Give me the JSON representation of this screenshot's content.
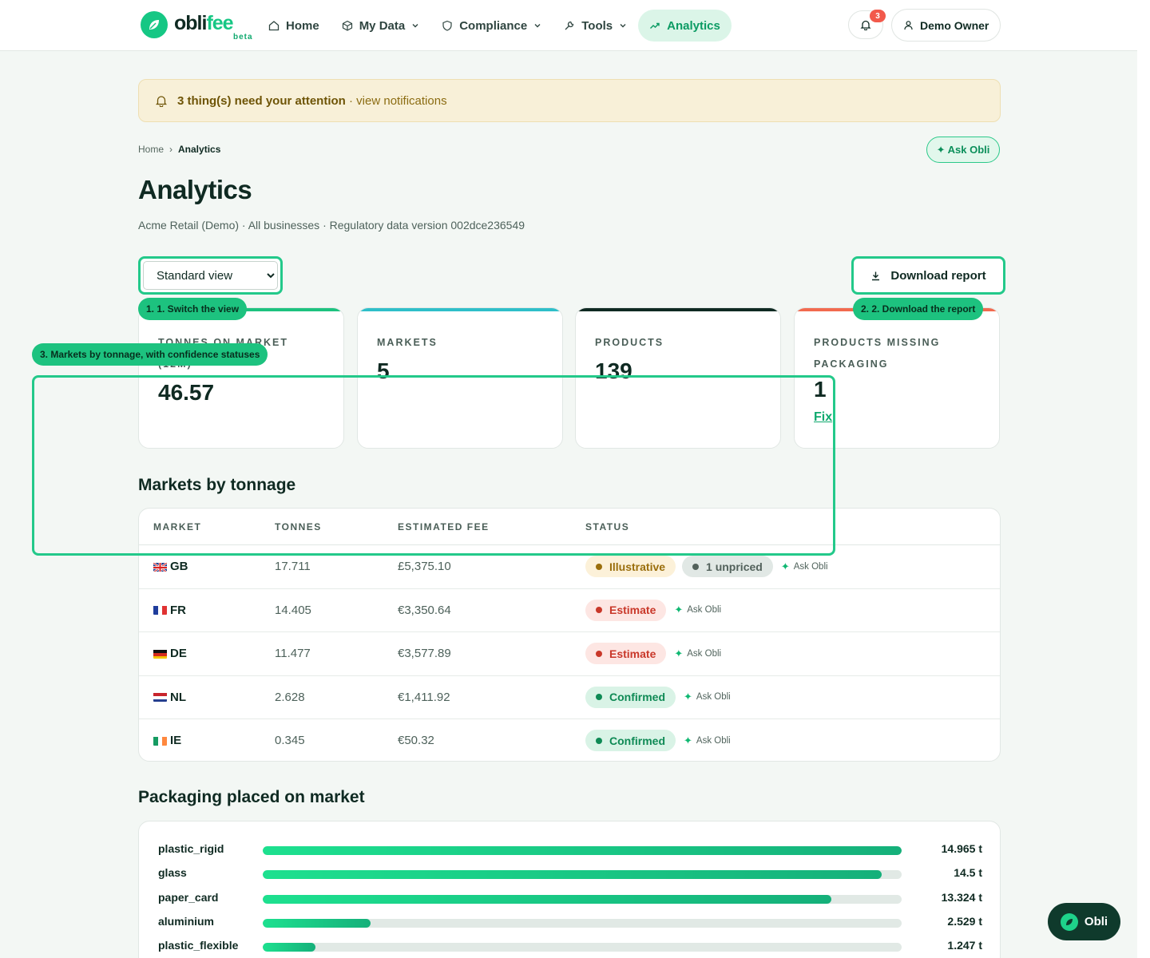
{
  "brand": {
    "name_a": "obli",
    "name_b": "fee",
    "tag": "beta"
  },
  "nav": [
    {
      "label": "Home",
      "icon": "home-icon"
    },
    {
      "label": "My Data",
      "icon": "box-icon"
    },
    {
      "label": "Compliance",
      "icon": "shield-icon"
    },
    {
      "label": "Tools",
      "icon": "wrench-icon"
    },
    {
      "label": "Analytics",
      "icon": "trend-icon",
      "active": true
    }
  ],
  "notifications": {
    "count": "3"
  },
  "user": {
    "name": "Demo Owner"
  },
  "banner": {
    "strong": "3 thing(s) need your attention",
    "link": "· view notifications"
  },
  "breadcrumb": {
    "home": "Home",
    "sep": "›",
    "current": "Analytics"
  },
  "ask_obli_label": "✦ Ask Obli",
  "page": {
    "title": "Analytics",
    "subtitle": "Acme Retail (Demo) · All businesses · Regulatory data version 002dce236549"
  },
  "view_select": {
    "selected": "Standard view"
  },
  "download_label": "Download report",
  "tour": {
    "step1": "1. 1. Switch the view",
    "step2": "2. 2. Download the report",
    "step3": "3. Markets by tonnage, with confidence statuses"
  },
  "kpis": [
    {
      "label": "TONNES ON MARKET (12M)",
      "value": "46.57",
      "accent": "#1dc27f"
    },
    {
      "label": "MARKETS",
      "value": "5",
      "accent": "#2fbfc9"
    },
    {
      "label": "PRODUCTS",
      "value": "139",
      "accent": "#0f2a22"
    },
    {
      "label": "PRODUCTS MISSING PACKAGING",
      "value": "1",
      "accent": "#f26a4f",
      "link": "Fix"
    }
  ],
  "markets": {
    "heading": "Markets by tonnage",
    "columns": [
      "MARKET",
      "TONNES",
      "ESTIMATED FEE",
      "STATUS"
    ],
    "rows": [
      {
        "code": "GB",
        "tonnes": "17.711",
        "fee": "£5,375.10",
        "status": "Illustrative",
        "extra": "1 unpriced",
        "ask": "Ask Obli"
      },
      {
        "code": "FR",
        "tonnes": "14.405",
        "fee": "€3,350.64",
        "status": "Estimate",
        "ask": "Ask Obli"
      },
      {
        "code": "DE",
        "tonnes": "11.477",
        "fee": "€3,577.89",
        "status": "Estimate",
        "ask": "Ask Obli"
      },
      {
        "code": "NL",
        "tonnes": "2.628",
        "fee": "€1,411.92",
        "status": "Confirmed",
        "ask": "Ask Obli"
      },
      {
        "code": "IE",
        "tonnes": "0.345",
        "fee": "€50.32",
        "status": "Confirmed",
        "ask": "Ask Obli"
      }
    ]
  },
  "packaging": {
    "heading": "Packaging placed on market",
    "rows": [
      {
        "label": "plastic_rigid",
        "value": "14.965 t",
        "fraction": 1.0
      },
      {
        "label": "glass",
        "value": "14.5 t",
        "fraction": 0.969
      },
      {
        "label": "paper_card",
        "value": "13.324 t",
        "fraction": 0.89
      },
      {
        "label": "aluminium",
        "value": "2.529 t",
        "fraction": 0.169
      },
      {
        "label": "plastic_flexible",
        "value": "1.247 t",
        "fraction": 0.083
      }
    ]
  },
  "fab": {
    "label": "Obli"
  }
}
